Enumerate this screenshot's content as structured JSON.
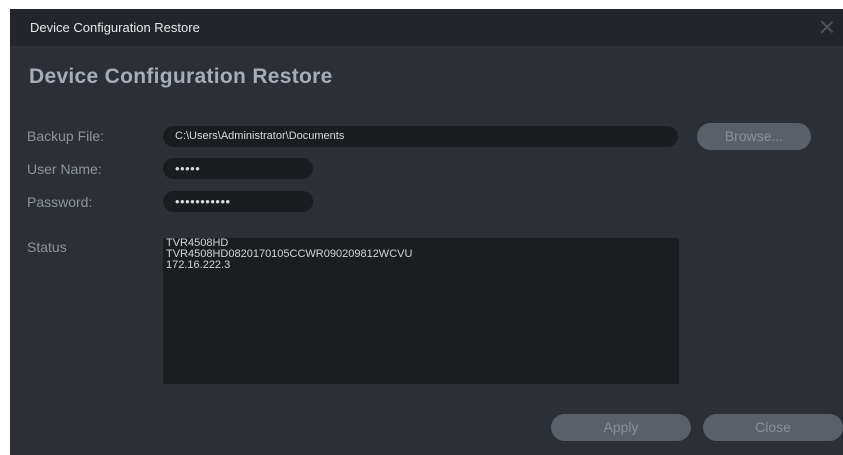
{
  "window": {
    "title": "Device Configuration Restore"
  },
  "heading": "Device Configuration Restore",
  "form": {
    "backup_file": {
      "label": "Backup File:",
      "value": "C:\\Users\\Administrator\\Documents"
    },
    "browse_label": "Browse...",
    "user_name": {
      "label": "User Name:",
      "value": "•••••"
    },
    "password": {
      "label": "Password:",
      "value": "•••••••••••"
    }
  },
  "status": {
    "label": "Status",
    "lines": [
      "TVR4508HD",
      "TVR4508HD0820170105CCWR090209812WCVU",
      "172.16.222.3"
    ]
  },
  "buttons": {
    "apply_label": "Apply",
    "close_label": "Close"
  },
  "icons": {
    "close": "close-icon"
  }
}
